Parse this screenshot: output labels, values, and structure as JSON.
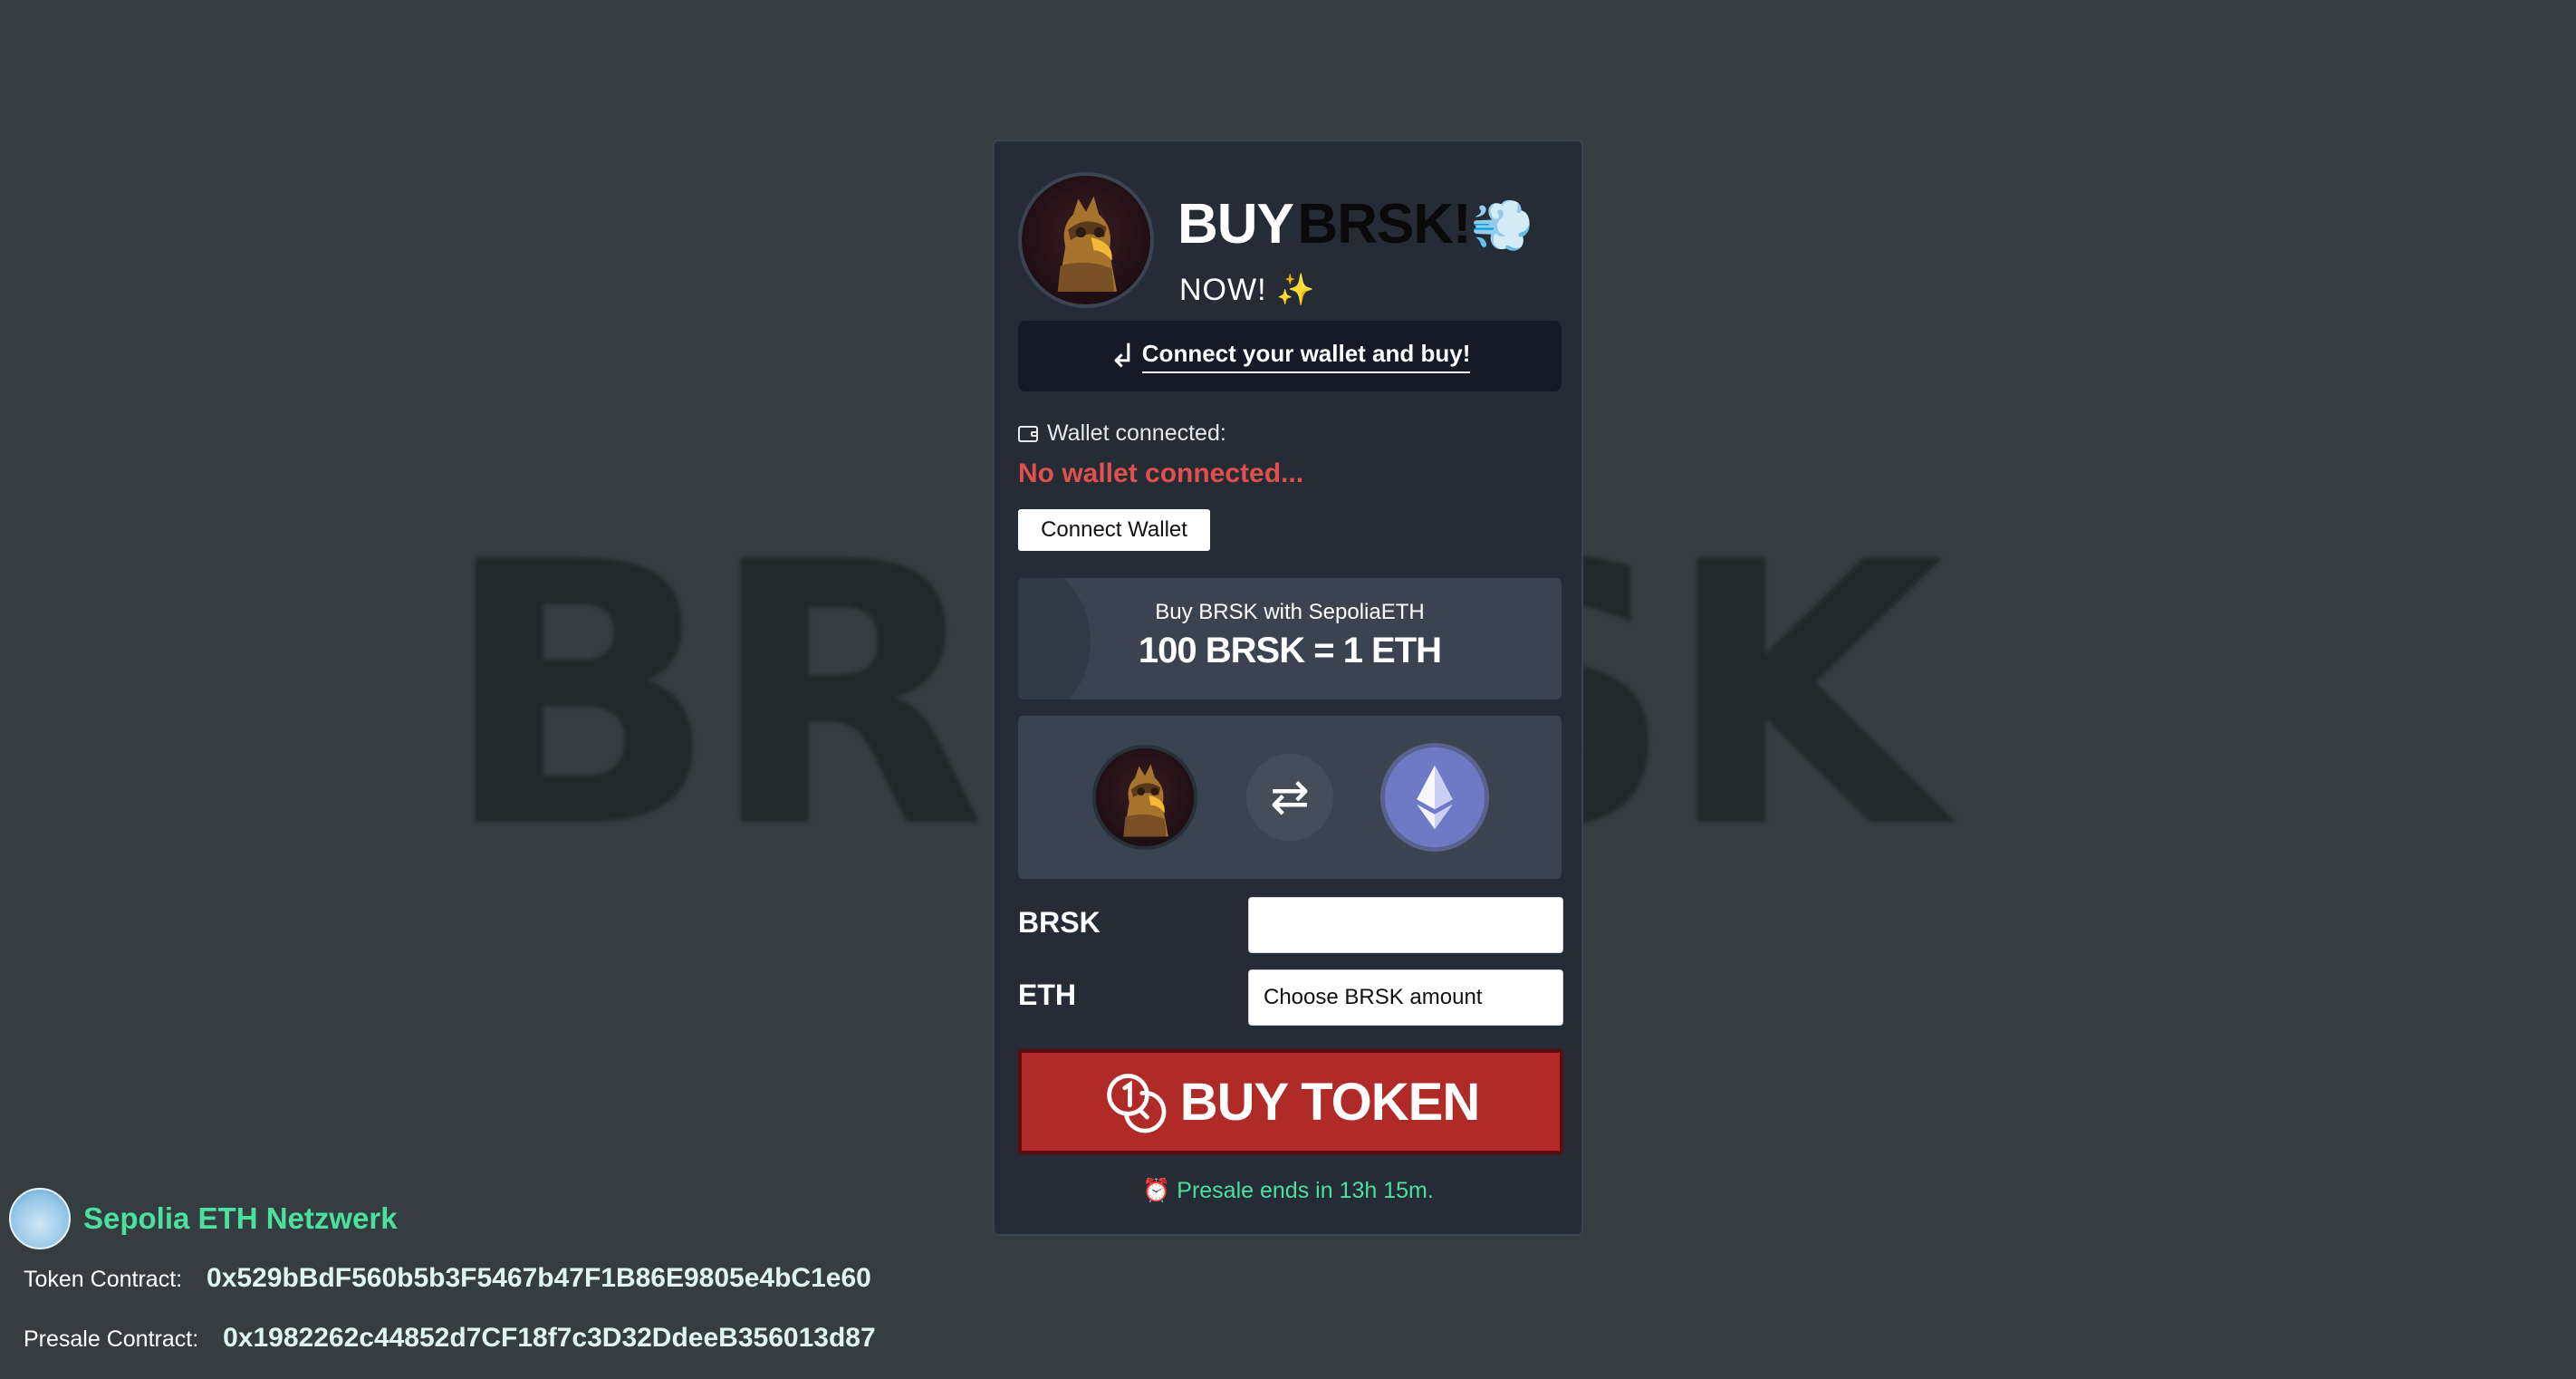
{
  "background": {
    "watermark": "BRR_SK"
  },
  "header": {
    "title_buy": "BUY",
    "title_name": "BRSK!",
    "title_emoji": "💨",
    "subtitle": "NOW!",
    "subtitle_emoji": "✨"
  },
  "banner": {
    "arrow": "↲",
    "text": "Connect your wallet and buy!"
  },
  "wallet": {
    "label": "Wallet connected:",
    "status": "No wallet connected...",
    "connect_button": "Connect Wallet"
  },
  "rate": {
    "subtitle": "Buy BRSK with SepoliaETH",
    "main": "100 BRSK = 1 ETH"
  },
  "swap": {
    "icon": "⇄"
  },
  "form": {
    "brsk_label": "BRSK",
    "brsk_value": "",
    "eth_label": "ETH",
    "eth_placeholder": "Choose BRSK amount"
  },
  "buy_button": {
    "label": "BUY TOKEN"
  },
  "presale": {
    "clock": "⏰",
    "text": "Presale ends in 13h 15m."
  },
  "network": {
    "name": "Sepolia ETH Netzwerk"
  },
  "contracts": {
    "token_label": "Token Contract:",
    "token_address": "0x529bBdF560b5b3F5467b47F1B86E9805e4bC1e60",
    "presale_label": "Presale Contract:",
    "presale_address": "0x1982262c44852d7CF18f7c3D32DdeeB356013d87"
  },
  "colors": {
    "page_bg": "#353d40",
    "card_bg": "#252c36",
    "error": "#e0504d",
    "accent_green": "#4be09f",
    "buy_red": "#b02a27"
  }
}
